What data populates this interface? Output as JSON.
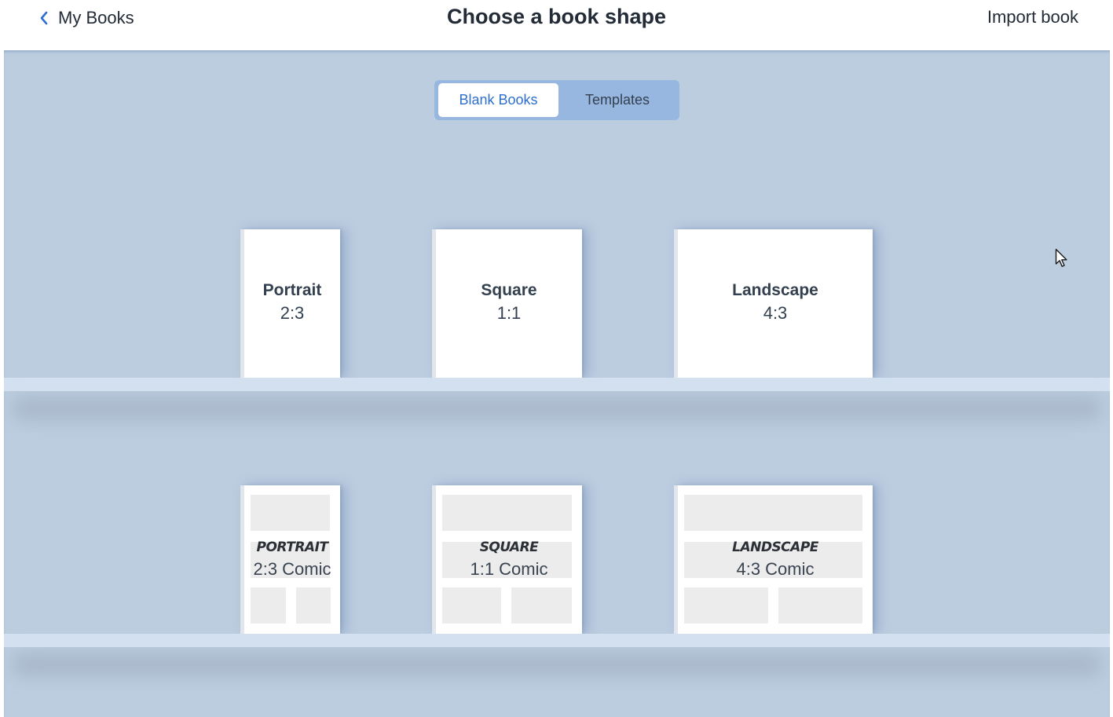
{
  "header": {
    "back_label": "My Books",
    "title": "Choose a book shape",
    "import_label": "Import book"
  },
  "tabs": [
    {
      "label": "Blank Books",
      "active": true
    },
    {
      "label": "Templates",
      "active": false
    }
  ],
  "blank_books": [
    {
      "name": "Portrait",
      "ratio": "2:3"
    },
    {
      "name": "Square",
      "ratio": "1:1"
    },
    {
      "name": "Landscape",
      "ratio": "4:3"
    }
  ],
  "comic_books": [
    {
      "name": "PORTRAIT",
      "ratio": "2:3 Comic"
    },
    {
      "name": "SQUARE",
      "ratio": "1:1 Comic"
    },
    {
      "name": "LANDSCAPE",
      "ratio": "4:3 Comic"
    }
  ],
  "icons": {
    "back": "chevron-left-icon",
    "cursor": "mouse-pointer-icon"
  },
  "colors": {
    "accent": "#2f6fcd",
    "background": "#bccde0",
    "tab_track": "#97b7e1",
    "shelf": "#d2e0f0",
    "panel": "#ececec"
  }
}
